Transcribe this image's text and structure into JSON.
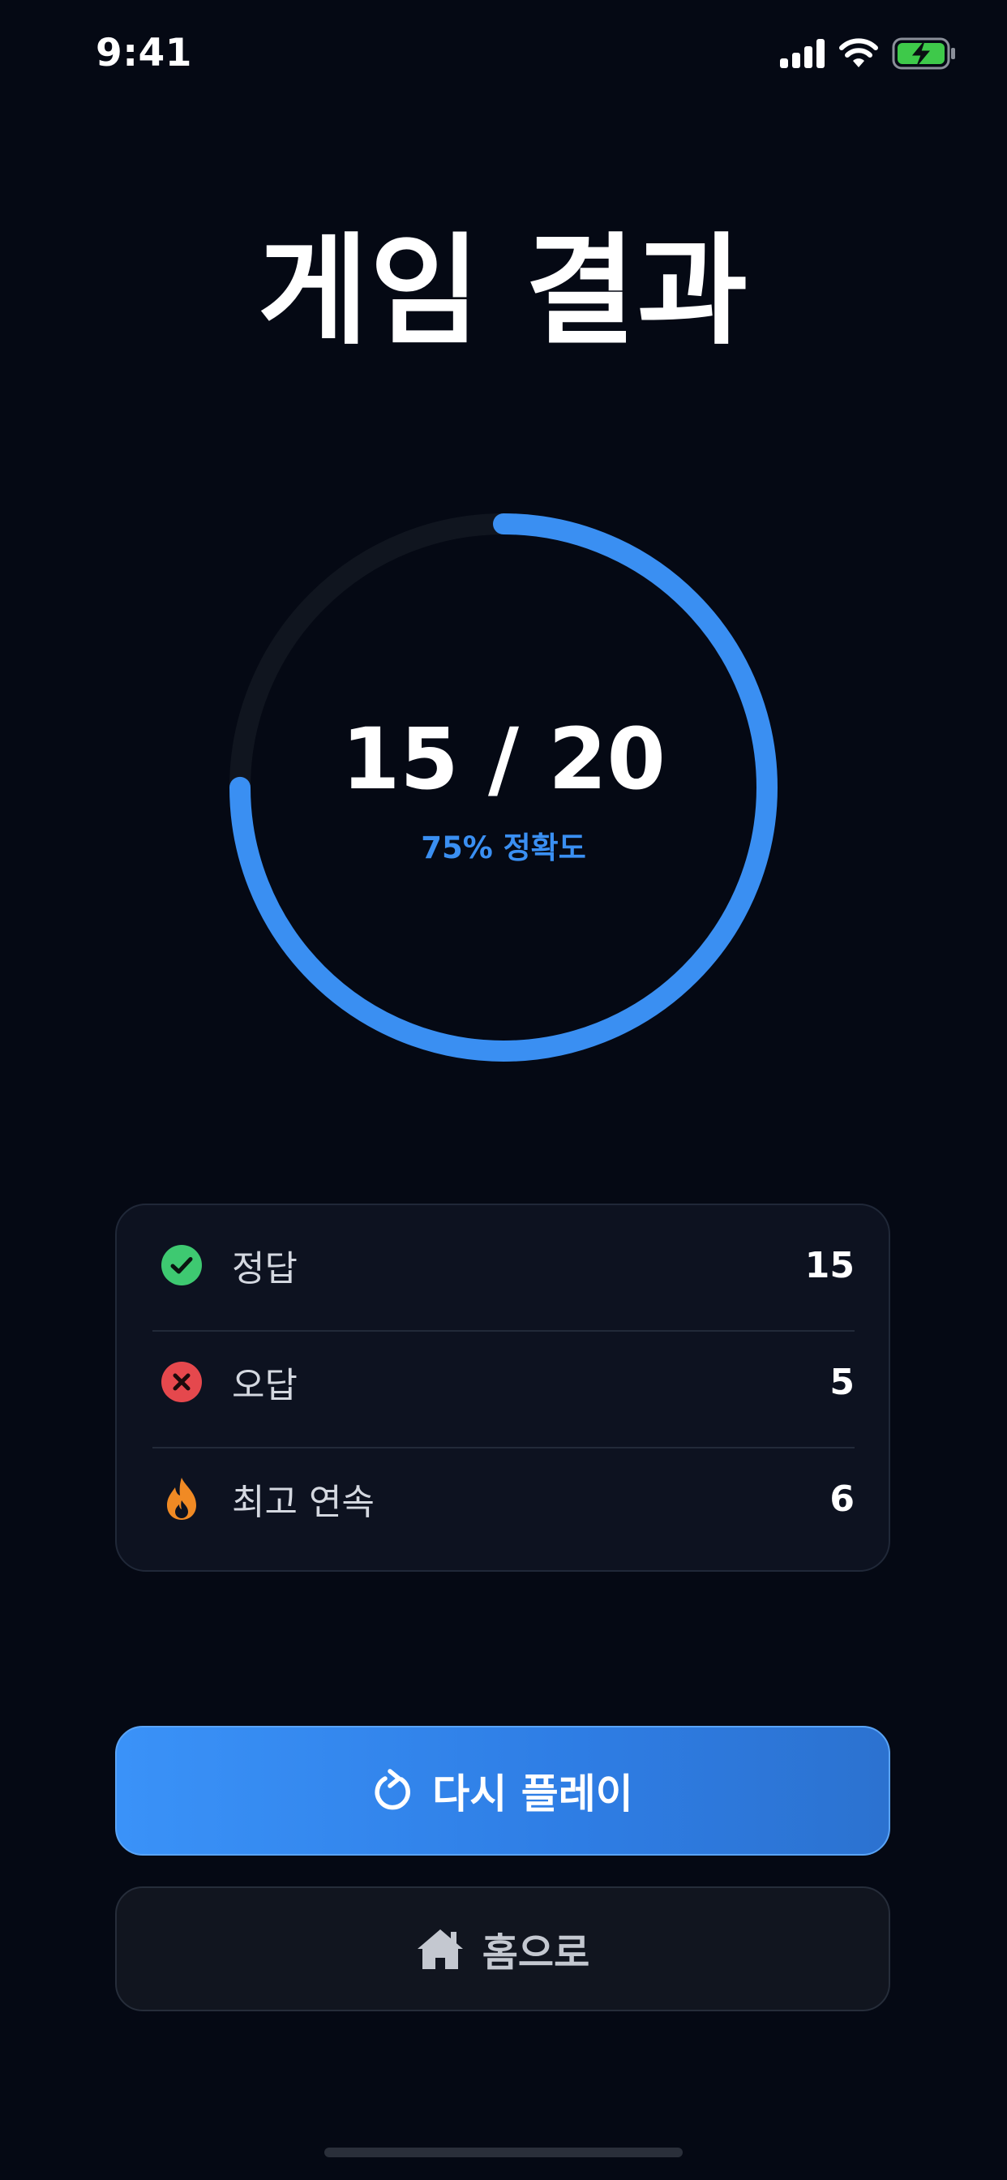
{
  "status_bar": {
    "time": "9:41"
  },
  "title": "게임 결과",
  "result": {
    "score": "15 / 20",
    "accuracy_label": "75% 정확도",
    "progress_fraction": 0.75,
    "ring_color": "#3a8ff2",
    "track_color": "#10151f"
  },
  "stats": [
    {
      "label": "정답",
      "value": "15",
      "icon": "check-circle-icon",
      "color": "#3ec971"
    },
    {
      "label": "오답",
      "value": "5",
      "icon": "x-circle-icon",
      "color": "#e5484d"
    },
    {
      "label": "최고 연속",
      "value": "6",
      "icon": "fire-icon",
      "color": "#f08a24"
    }
  ],
  "buttons": {
    "replay_label": "다시 플레이",
    "home_label": "홈으로"
  }
}
